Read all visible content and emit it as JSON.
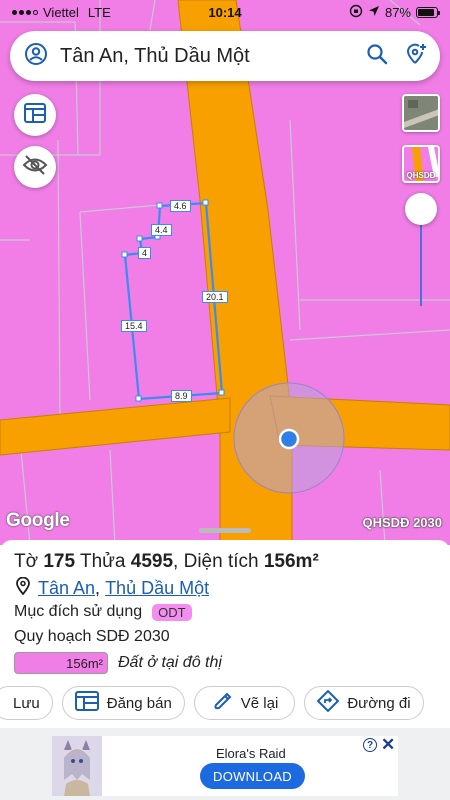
{
  "status_bar": {
    "carrier": "Viettel",
    "network": "LTE",
    "time": "10:14",
    "battery": "87%",
    "battery_level": 0.87
  },
  "search": {
    "location": "Tân An, Thủ Dầu Một"
  },
  "map": {
    "zoning_color": "#f07ee6",
    "road_color": "#f7a000",
    "parcel_edges": {
      "top": "4.6",
      "left_upper": "4.4",
      "step": "4",
      "left": "15.4",
      "right": "20.1",
      "bottom": "8.9"
    },
    "google_logo": "Google",
    "layer_name": "QHSDĐ 2030",
    "layer_thumb_label": "QHSDĐ"
  },
  "parcel": {
    "sheet_label": "Tờ",
    "sheet_no": "175",
    "parcel_label": "Thửa",
    "parcel_no": "4595",
    "area_label": "Diện tích",
    "area": "156m²",
    "ward": "Tân An",
    "city": "Thủ Dầu Một",
    "purpose_label": "Mục đích sử dụng",
    "purpose_code": "ODT",
    "plan_label": "Quy hoạch SDĐ 2030",
    "plan_area": "156m²",
    "plan_area_fraction": 1.0,
    "plan_use": "Đất ở tại đô thị"
  },
  "actions": {
    "save": "Lưu",
    "post_sale": "Đăng bán",
    "redraw": "Vẽ lại",
    "directions": "Đường đi"
  },
  "ad": {
    "title": "Elora's Raid",
    "button": "DOWNLOAD",
    "info": "?"
  }
}
